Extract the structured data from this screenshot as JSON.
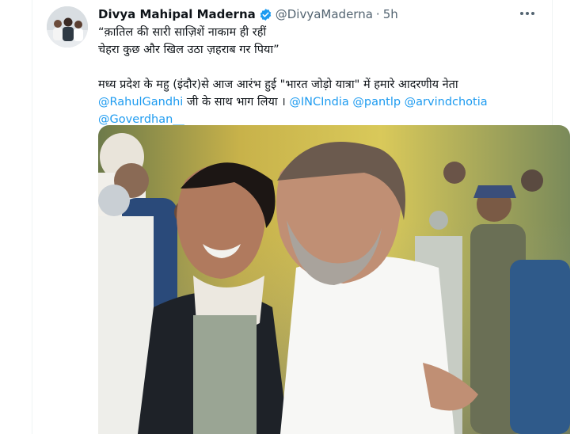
{
  "tweet": {
    "display_name": "Divya Mahipal Maderna",
    "handle": "@DivyaMaderna",
    "separator": "·",
    "time": "5h",
    "more_icon": "more-horizontal-icon",
    "line1": "“क़ातिल की सारी साज़िशें नाकाम ही रहीं",
    "line2": "चेहरा कुछ और खिल उठा ज़हराब गर पिया”",
    "line3": "मध्य प्रदेश के महु (इंदौर)से आज आरंभ हुई \"भारत जोड़ो यात्रा\" में हमारे आदरणीय नेता",
    "mention_rahul": "@RahulGandhi",
    "line4_mid": " जी के साथ भाग लिया । ",
    "mention_inc": "@INCIndia",
    "mention_pantlp": " @pantlp",
    "mention_arvind": " @arvindchotia",
    "mention_goverdhan": "@Goverdhan__"
  },
  "colors": {
    "link": "#1d9bf0",
    "verified": "#1d9bf0",
    "text": "#0f1419",
    "muted": "#536471"
  }
}
